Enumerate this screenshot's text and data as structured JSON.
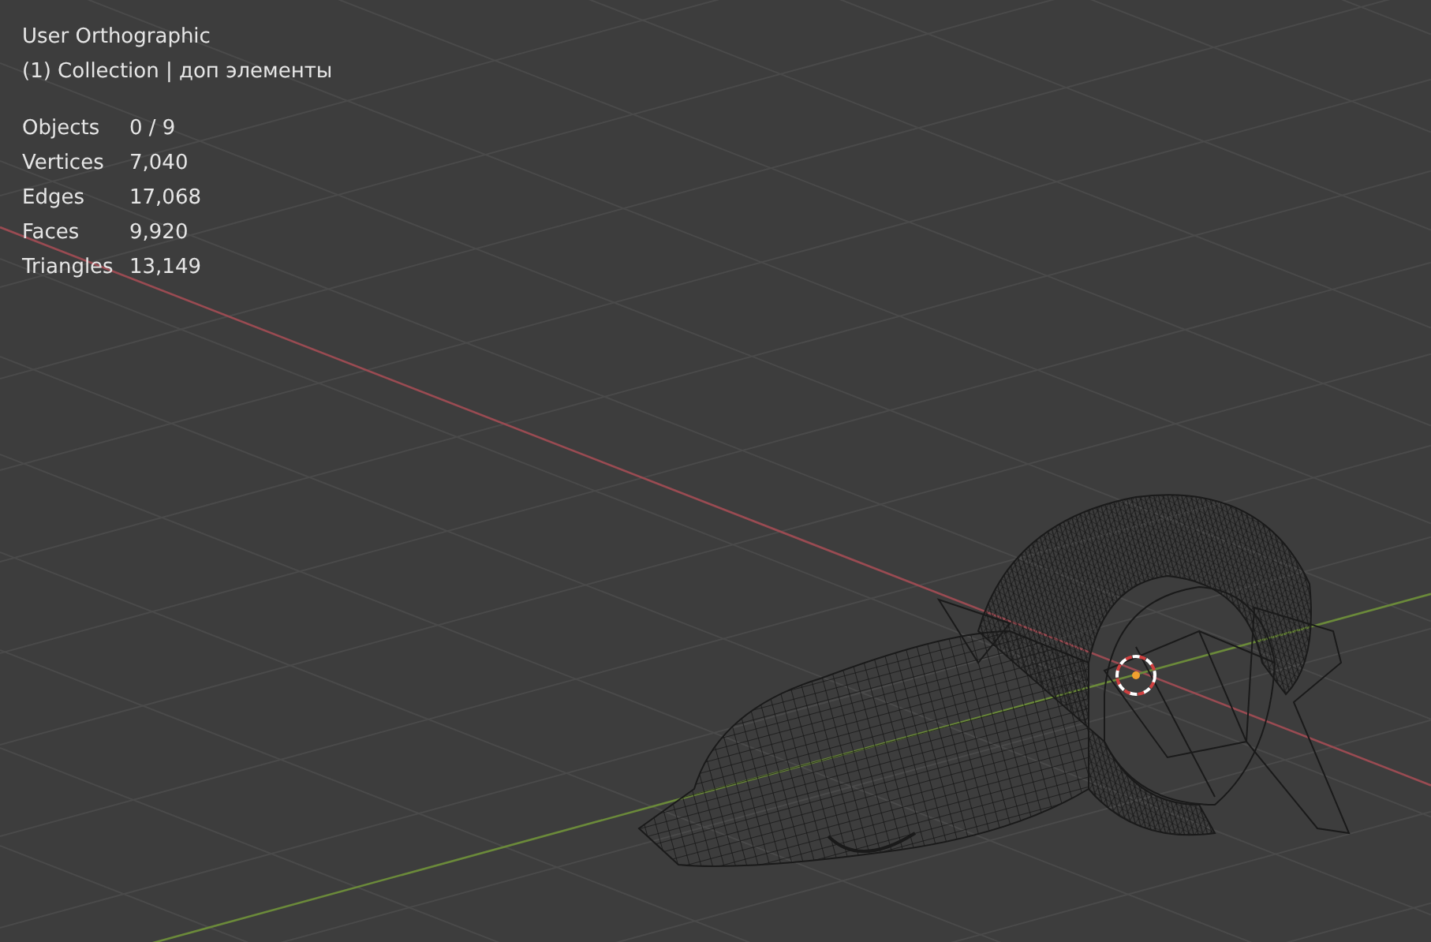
{
  "viewport": {
    "view_name": "User Orthographic",
    "collection": "(1) Collection | доп элементы",
    "stats": [
      {
        "label": "Objects",
        "value": "0 / 9"
      },
      {
        "label": "Vertices",
        "value": "7,040"
      },
      {
        "label": "Edges",
        "value": "17,068"
      },
      {
        "label": "Faces",
        "value": "9,920"
      },
      {
        "label": "Triangles",
        "value": "13,149"
      }
    ]
  }
}
